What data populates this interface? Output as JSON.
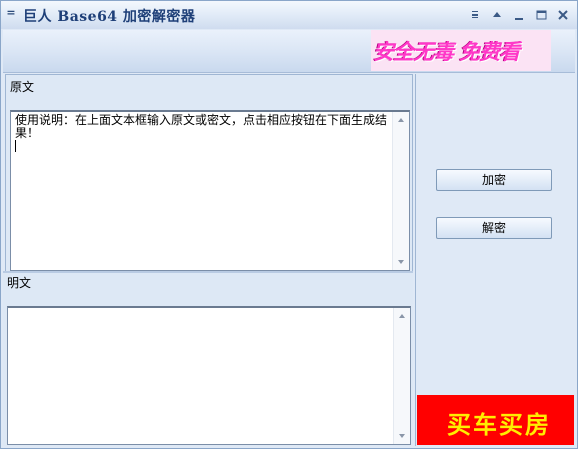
{
  "window": {
    "title": "巨人 Base64 加密解密器",
    "system_menu_glyph": "=",
    "controls": [
      "menu-icon",
      "rollup-icon",
      "minimize-icon",
      "maximize-icon",
      "close-icon"
    ]
  },
  "banner": {
    "ad_text": "安全无毒 免费看"
  },
  "source": {
    "label": "原文",
    "value": "使用说明：在上面文本框输入原文或密文，点击相应按钮在下面生成结果！"
  },
  "result": {
    "label": "明文",
    "value": ""
  },
  "actions": {
    "encrypt_label": "加密",
    "decrypt_label": "解密"
  },
  "side_ad": {
    "text": "买车买房",
    "background": "#ff0000",
    "text_color": "#ffee00"
  },
  "colors": {
    "title_text": "#1e3f78",
    "frame": "#dfe9f6",
    "border": "#9fb6d3"
  }
}
